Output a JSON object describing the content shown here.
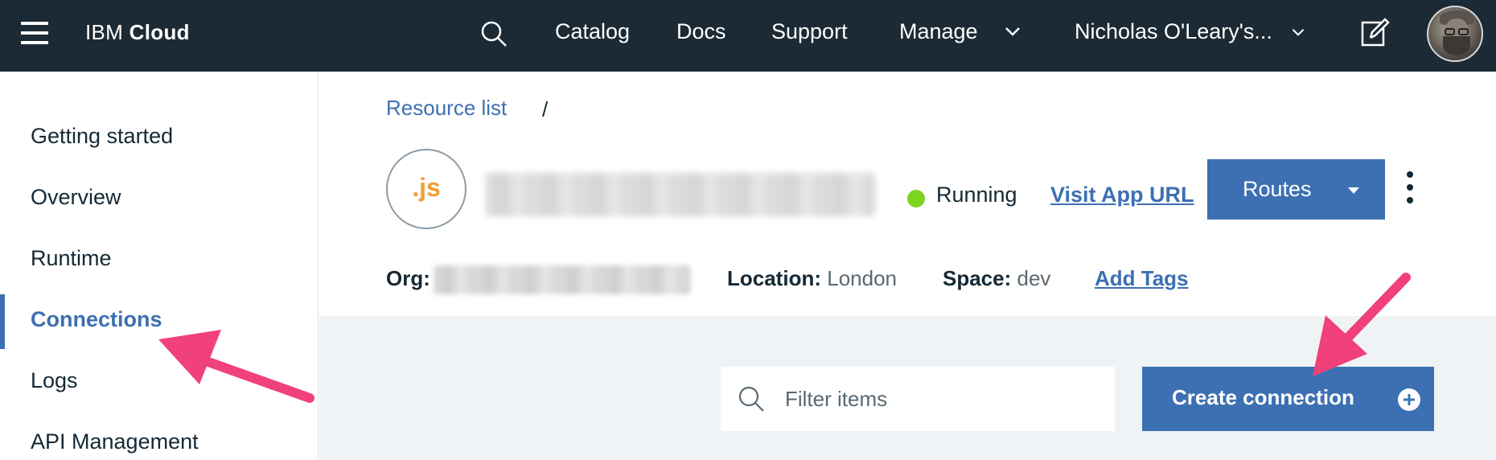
{
  "topbar": {
    "brand_prefix": "IBM",
    "brand_name": "Cloud",
    "nav": {
      "catalog": "Catalog",
      "docs": "Docs",
      "support": "Support",
      "manage": "Manage",
      "account": "Nicholas O'Leary's..."
    }
  },
  "sidebar": {
    "items": [
      {
        "label": "Getting started"
      },
      {
        "label": "Overview"
      },
      {
        "label": "Runtime"
      },
      {
        "label": "Connections",
        "active": true
      },
      {
        "label": "Logs"
      },
      {
        "label": "API Management"
      }
    ]
  },
  "header": {
    "breadcrumb_link": "Resource list",
    "breadcrumb_separator": "/",
    "app_icon_text": ".js",
    "status": "Running",
    "visit_url": "Visit App URL",
    "routes_button": "Routes",
    "org_label": "Org:",
    "location_label": "Location:",
    "location_value": "London",
    "space_label": "Space:",
    "space_value": "dev",
    "add_tags": "Add Tags"
  },
  "main": {
    "filter_placeholder": "Filter items",
    "create_button": "Create connection"
  },
  "colors": {
    "topbar_bg": "#1c2a35",
    "accent": "#3d70b2",
    "status_running": "#7ed321",
    "nodejs_icon": "#f29d36",
    "annotation_arrow": "#f0417a"
  }
}
